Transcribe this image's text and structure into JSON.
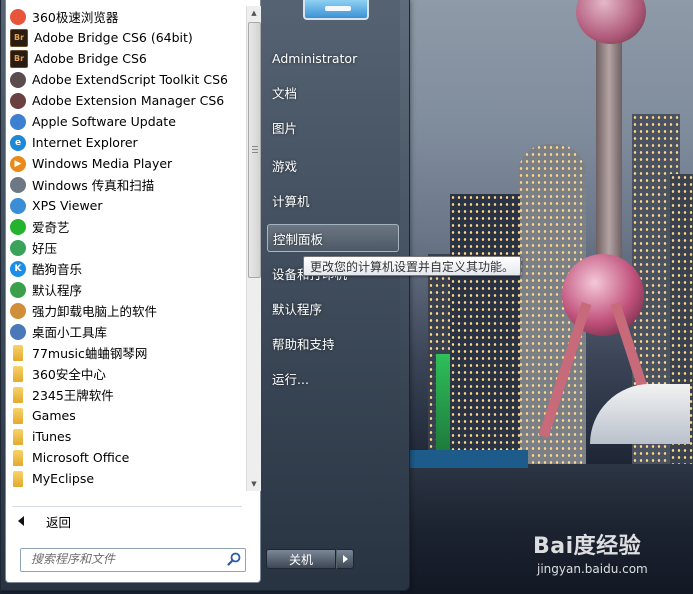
{
  "start_menu": {
    "programs": [
      {
        "label": "360极速浏览器",
        "icon": "360-browser-icon",
        "badge": "",
        "color": "#e8553a"
      },
      {
        "label": "Adobe Bridge CS6 (64bit)",
        "icon": "adobe-bridge-icon",
        "badge": "Br",
        "color": "#2b1c12"
      },
      {
        "label": "Adobe Bridge CS6",
        "icon": "adobe-bridge-icon",
        "badge": "Br",
        "color": "#2b1c12"
      },
      {
        "label": "Adobe ExtendScript Toolkit CS6",
        "icon": "extendscript-icon",
        "badge": "",
        "color": "#5a4c4c"
      },
      {
        "label": "Adobe Extension Manager CS6",
        "icon": "extension-manager-icon",
        "badge": "",
        "color": "#6a4040"
      },
      {
        "label": "Apple Software Update",
        "icon": "apple-update-icon",
        "badge": "",
        "color": "#3d7fd1"
      },
      {
        "label": "Internet Explorer",
        "icon": "internet-explorer-icon",
        "badge": "e",
        "color": "#1e88d8"
      },
      {
        "label": "Windows Media Player",
        "icon": "media-player-icon",
        "badge": "▶",
        "color": "#e98a1a"
      },
      {
        "label": "Windows 传真和扫描",
        "icon": "fax-scan-icon",
        "badge": "",
        "color": "#6d7884"
      },
      {
        "label": "XPS Viewer",
        "icon": "xps-viewer-icon",
        "badge": "",
        "color": "#3b8ed6"
      },
      {
        "label": "爱奇艺",
        "icon": "iqiyi-icon",
        "badge": "",
        "color": "#25b32e"
      },
      {
        "label": "好压",
        "icon": "haozip-icon",
        "badge": "",
        "color": "#3aa35a"
      },
      {
        "label": "酷狗音乐",
        "icon": "kugou-icon",
        "badge": "K",
        "color": "#1b8ee8"
      },
      {
        "label": "默认程序",
        "icon": "default-programs-icon",
        "badge": "",
        "color": "#3ca04a"
      },
      {
        "label": "强力卸载电脑上的软件",
        "icon": "uninstall-icon",
        "badge": "",
        "color": "#d08d3a"
      },
      {
        "label": "桌面小工具库",
        "icon": "gadgets-icon",
        "badge": "",
        "color": "#4a78b8"
      },
      {
        "label": "77music蛐蛐钢琴网",
        "icon": "folder-icon",
        "badge": "",
        "color": "folder"
      },
      {
        "label": "360安全中心",
        "icon": "folder-icon",
        "badge": "",
        "color": "folder"
      },
      {
        "label": "2345王牌软件",
        "icon": "folder-icon",
        "badge": "",
        "color": "folder"
      },
      {
        "label": "Games",
        "icon": "folder-icon",
        "badge": "",
        "color": "folder"
      },
      {
        "label": "iTunes",
        "icon": "folder-icon",
        "badge": "",
        "color": "folder"
      },
      {
        "label": "Microsoft Office",
        "icon": "folder-icon",
        "badge": "",
        "color": "folder"
      },
      {
        "label": "MyEclipse",
        "icon": "folder-icon",
        "badge": "",
        "color": "folder"
      }
    ],
    "back_label": "返回",
    "search": {
      "placeholder": "搜索程序和文件"
    },
    "right_items": [
      {
        "label": "Administrator",
        "name": "right-item-administrator",
        "selected": false
      },
      {
        "label": "文档",
        "name": "right-item-documents",
        "selected": false
      },
      {
        "label": "图片",
        "name": "right-item-pictures",
        "selected": false
      },
      {
        "label": "游戏",
        "name": "right-item-games",
        "selected": false
      },
      {
        "label": "计算机",
        "name": "right-item-computer",
        "selected": false
      },
      {
        "label": "控制面板",
        "name": "right-item-control-panel",
        "selected": true
      },
      {
        "label": "设备和打印机",
        "name": "right-item-devices-printers",
        "selected": false
      },
      {
        "label": "默认程序",
        "name": "right-item-default-programs",
        "selected": false
      },
      {
        "label": "帮助和支持",
        "name": "right-item-help-support",
        "selected": false
      },
      {
        "label": "运行...",
        "name": "right-item-run",
        "selected": false
      }
    ],
    "shutdown_label": "关机",
    "tooltip": "更改您的计算机设置并自定义其功能。"
  },
  "watermark": {
    "logo": "Bai度经验",
    "url": "jingyan.baidu.com"
  }
}
